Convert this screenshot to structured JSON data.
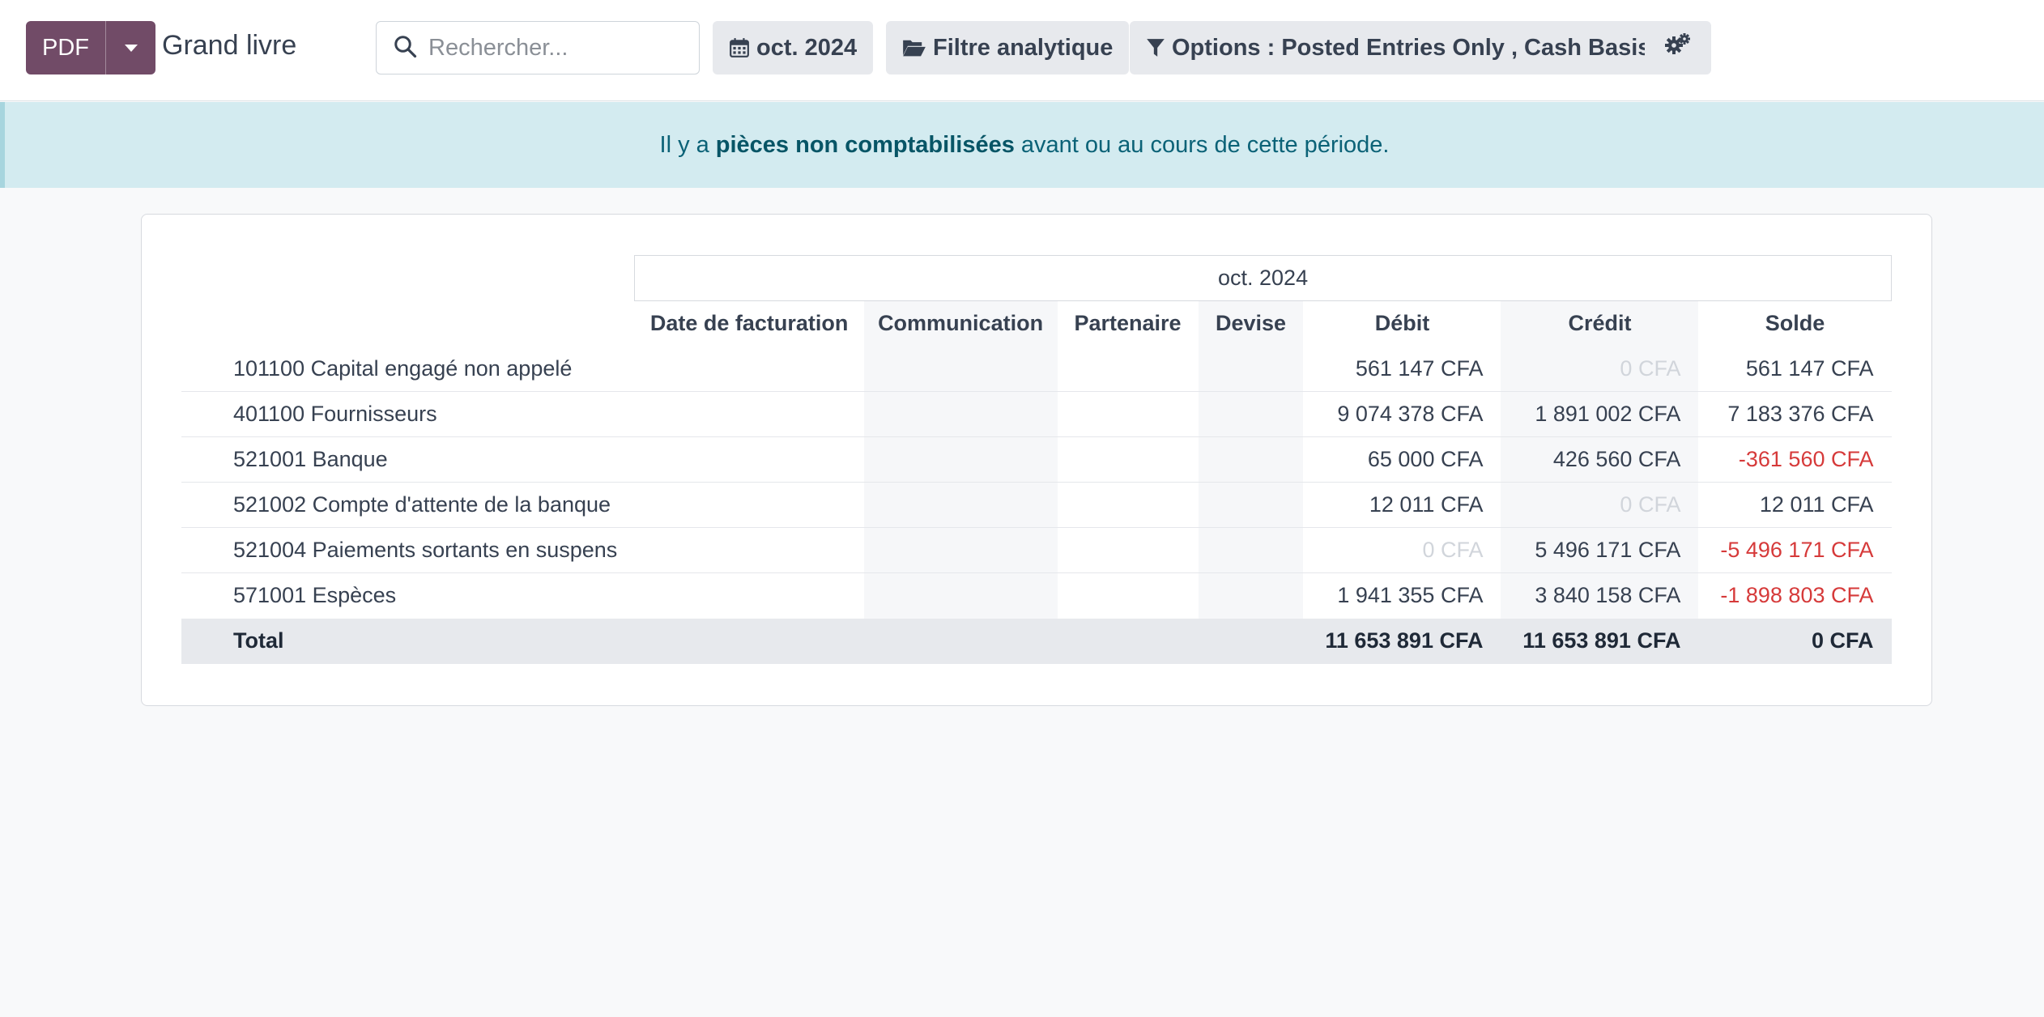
{
  "toolbar": {
    "pdf_label": "PDF",
    "title": "Grand livre",
    "search_placeholder": "Rechercher...",
    "date_filter": "oct. 2024",
    "analytic_filter": "Filtre analytique",
    "options_filter": "Options : Posted Entries Only , Cash Basis",
    "accent_color": "#714b67"
  },
  "banner": {
    "prefix": "Il y a",
    "link": "pièces non comptabilisées",
    "suffix": "avant ou au cours de cette période."
  },
  "report": {
    "period": "oct. 2024",
    "columns": {
      "invoice_date": "Date de facturation",
      "communication": "Communication",
      "partner": "Partenaire",
      "currency": "Devise",
      "debit": "Débit",
      "credit": "Crédit",
      "balance": "Solde"
    },
    "rows": [
      {
        "name": "101100 Capital engagé non appelé",
        "debit": "561 147 CFA",
        "credit": "0 CFA",
        "balance": "561 147 CFA"
      },
      {
        "name": "401100 Fournisseurs",
        "debit": "9 074 378 CFA",
        "credit": "1 891 002 CFA",
        "balance": "7 183 376 CFA"
      },
      {
        "name": "521001 Banque",
        "debit": "65 000 CFA",
        "credit": "426 560 CFA",
        "balance": "-361 560 CFA"
      },
      {
        "name": "521002 Compte d'attente de la banque",
        "debit": "12 011 CFA",
        "credit": "0 CFA",
        "balance": "12 011 CFA"
      },
      {
        "name": "521004 Paiements sortants en suspens",
        "debit": "0 CFA",
        "credit": "5 496 171 CFA",
        "balance": "-5 496 171 CFA"
      },
      {
        "name": "571001 Espèces",
        "debit": "1 941 355 CFA",
        "credit": "3 840 158 CFA",
        "balance": "-1 898 803 CFA"
      }
    ],
    "total": {
      "label": "Total",
      "debit": "11 653 891 CFA",
      "credit": "11 653 891 CFA",
      "balance": "0 CFA"
    },
    "negative_color": "#d63a3a",
    "zero_color": "#d1d5db"
  }
}
